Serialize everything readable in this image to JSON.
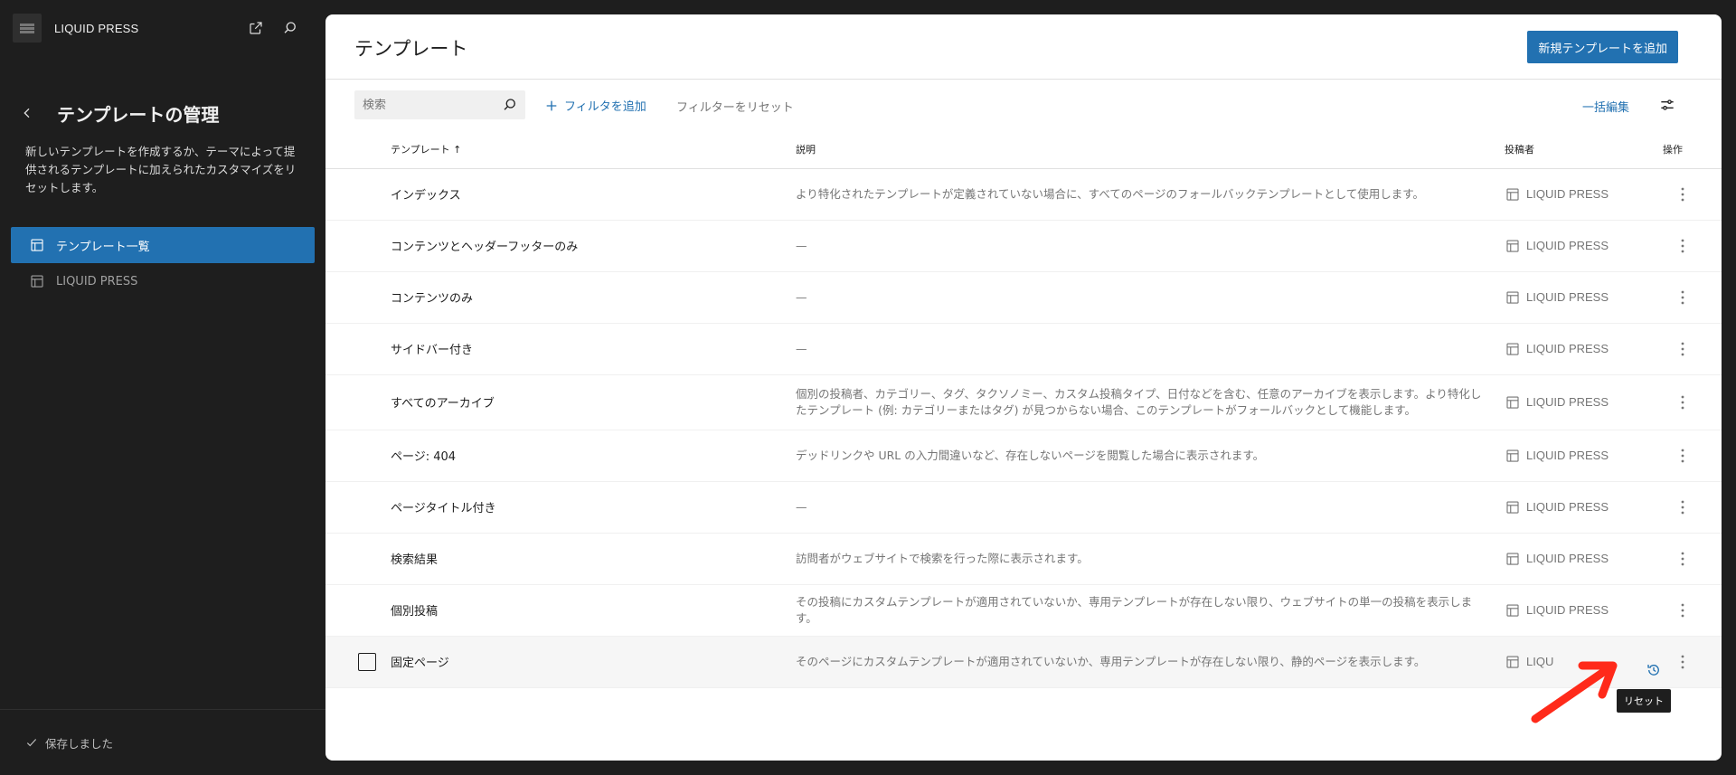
{
  "site": {
    "name": "LIQUID PRESS"
  },
  "sidebar": {
    "title": "テンプレートの管理",
    "description": "新しいテンプレートを作成するか、テーマによって提供されるテンプレートに加えられたカスタマイズをリセットします。",
    "items": [
      {
        "label": "テンプレート一覧",
        "active": true
      },
      {
        "label": "LIQUID PRESS",
        "active": false
      }
    ],
    "footer_status": "保存しました"
  },
  "header": {
    "title": "テンプレート",
    "add_button": "新規テンプレートを追加"
  },
  "toolbar": {
    "search_placeholder": "検索",
    "add_filter": "フィルタを追加",
    "reset_filter": "フィルターをリセット",
    "bulk_edit": "一括編集"
  },
  "table": {
    "headers": {
      "template": "テンプレート ↑",
      "description": "説明",
      "author": "投稿者",
      "actions": "操作"
    },
    "rows": [
      {
        "name": "インデックス",
        "description": "より特化されたテンプレートが定義されていない場合に、すべてのページのフォールバックテンプレートとして使用します。",
        "author": "LIQUID PRESS"
      },
      {
        "name": "コンテンツとヘッダーフッターのみ",
        "description": "—",
        "author": "LIQUID PRESS"
      },
      {
        "name": "コンテンツのみ",
        "description": "—",
        "author": "LIQUID PRESS"
      },
      {
        "name": "サイドバー付き",
        "description": "—",
        "author": "LIQUID PRESS"
      },
      {
        "name": "すべてのアーカイブ",
        "description": "個別の投稿者、カテゴリー、タグ、タクソノミー、カスタム投稿タイプ、日付などを含む、任意のアーカイブを表示します。より特化したテンプレート (例: カテゴリーまたはタグ) が見つからない場合、このテンプレートがフォールバックとして機能します。",
        "author": "LIQUID PRESS"
      },
      {
        "name": "ページ: 404",
        "description": "デッドリンクや URL の入力間違いなど、存在しないページを閲覧した場合に表示されます。",
        "author": "LIQUID PRESS"
      },
      {
        "name": "ページタイトル付き",
        "description": "—",
        "author": "LIQUID PRESS"
      },
      {
        "name": "検索結果",
        "description": "訪問者がウェブサイトで検索を行った際に表示されます。",
        "author": "LIQUID PRESS"
      },
      {
        "name": "個別投稿",
        "description": "その投稿にカスタムテンプレートが適用されていないか、専用テンプレートが存在しない限り、ウェブサイトの単一の投稿を表示します。",
        "author": "LIQUID PRESS"
      },
      {
        "name": "固定ページ",
        "description": "そのページにカスタムテンプレートが適用されていないか、専用テンプレートが存在しない限り、静的ページを表示します。",
        "author": "LIQU"
      }
    ]
  },
  "tooltip": "リセット",
  "colors": {
    "accent": "#2271b1",
    "annotation": "#ff2a1a",
    "sidebar_bg": "#1e1e1e"
  }
}
